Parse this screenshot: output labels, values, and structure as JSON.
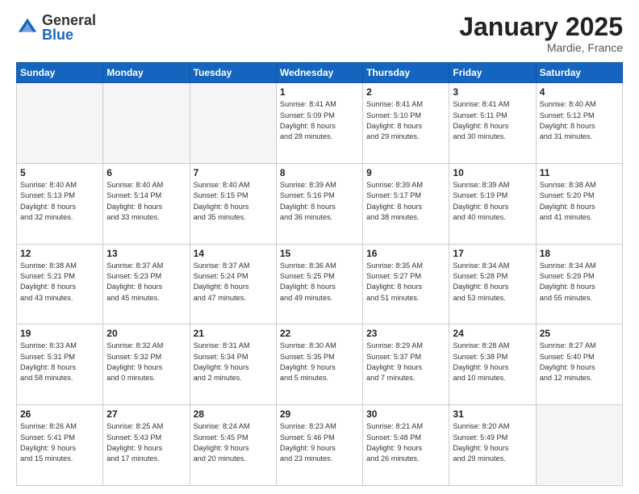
{
  "logo": {
    "general": "General",
    "blue": "Blue"
  },
  "header": {
    "month": "January 2025",
    "location": "Mardie, France"
  },
  "weekdays": [
    "Sunday",
    "Monday",
    "Tuesday",
    "Wednesday",
    "Thursday",
    "Friday",
    "Saturday"
  ],
  "weeks": [
    [
      {
        "day": "",
        "info": ""
      },
      {
        "day": "",
        "info": ""
      },
      {
        "day": "",
        "info": ""
      },
      {
        "day": "1",
        "info": "Sunrise: 8:41 AM\nSunset: 5:09 PM\nDaylight: 8 hours\nand 28 minutes."
      },
      {
        "day": "2",
        "info": "Sunrise: 8:41 AM\nSunset: 5:10 PM\nDaylight: 8 hours\nand 29 minutes."
      },
      {
        "day": "3",
        "info": "Sunrise: 8:41 AM\nSunset: 5:11 PM\nDaylight: 8 hours\nand 30 minutes."
      },
      {
        "day": "4",
        "info": "Sunrise: 8:40 AM\nSunset: 5:12 PM\nDaylight: 8 hours\nand 31 minutes."
      }
    ],
    [
      {
        "day": "5",
        "info": "Sunrise: 8:40 AM\nSunset: 5:13 PM\nDaylight: 8 hours\nand 32 minutes."
      },
      {
        "day": "6",
        "info": "Sunrise: 8:40 AM\nSunset: 5:14 PM\nDaylight: 8 hours\nand 33 minutes."
      },
      {
        "day": "7",
        "info": "Sunrise: 8:40 AM\nSunset: 5:15 PM\nDaylight: 8 hours\nand 35 minutes."
      },
      {
        "day": "8",
        "info": "Sunrise: 8:39 AM\nSunset: 5:16 PM\nDaylight: 8 hours\nand 36 minutes."
      },
      {
        "day": "9",
        "info": "Sunrise: 8:39 AM\nSunset: 5:17 PM\nDaylight: 8 hours\nand 38 minutes."
      },
      {
        "day": "10",
        "info": "Sunrise: 8:39 AM\nSunset: 5:19 PM\nDaylight: 8 hours\nand 40 minutes."
      },
      {
        "day": "11",
        "info": "Sunrise: 8:38 AM\nSunset: 5:20 PM\nDaylight: 8 hours\nand 41 minutes."
      }
    ],
    [
      {
        "day": "12",
        "info": "Sunrise: 8:38 AM\nSunset: 5:21 PM\nDaylight: 8 hours\nand 43 minutes."
      },
      {
        "day": "13",
        "info": "Sunrise: 8:37 AM\nSunset: 5:23 PM\nDaylight: 8 hours\nand 45 minutes."
      },
      {
        "day": "14",
        "info": "Sunrise: 8:37 AM\nSunset: 5:24 PM\nDaylight: 8 hours\nand 47 minutes."
      },
      {
        "day": "15",
        "info": "Sunrise: 8:36 AM\nSunset: 5:25 PM\nDaylight: 8 hours\nand 49 minutes."
      },
      {
        "day": "16",
        "info": "Sunrise: 8:35 AM\nSunset: 5:27 PM\nDaylight: 8 hours\nand 51 minutes."
      },
      {
        "day": "17",
        "info": "Sunrise: 8:34 AM\nSunset: 5:28 PM\nDaylight: 8 hours\nand 53 minutes."
      },
      {
        "day": "18",
        "info": "Sunrise: 8:34 AM\nSunset: 5:29 PM\nDaylight: 8 hours\nand 55 minutes."
      }
    ],
    [
      {
        "day": "19",
        "info": "Sunrise: 8:33 AM\nSunset: 5:31 PM\nDaylight: 8 hours\nand 58 minutes."
      },
      {
        "day": "20",
        "info": "Sunrise: 8:32 AM\nSunset: 5:32 PM\nDaylight: 9 hours\nand 0 minutes."
      },
      {
        "day": "21",
        "info": "Sunrise: 8:31 AM\nSunset: 5:34 PM\nDaylight: 9 hours\nand 2 minutes."
      },
      {
        "day": "22",
        "info": "Sunrise: 8:30 AM\nSunset: 5:35 PM\nDaylight: 9 hours\nand 5 minutes."
      },
      {
        "day": "23",
        "info": "Sunrise: 8:29 AM\nSunset: 5:37 PM\nDaylight: 9 hours\nand 7 minutes."
      },
      {
        "day": "24",
        "info": "Sunrise: 8:28 AM\nSunset: 5:38 PM\nDaylight: 9 hours\nand 10 minutes."
      },
      {
        "day": "25",
        "info": "Sunrise: 8:27 AM\nSunset: 5:40 PM\nDaylight: 9 hours\nand 12 minutes."
      }
    ],
    [
      {
        "day": "26",
        "info": "Sunrise: 8:26 AM\nSunset: 5:41 PM\nDaylight: 9 hours\nand 15 minutes."
      },
      {
        "day": "27",
        "info": "Sunrise: 8:25 AM\nSunset: 5:43 PM\nDaylight: 9 hours\nand 17 minutes."
      },
      {
        "day": "28",
        "info": "Sunrise: 8:24 AM\nSunset: 5:45 PM\nDaylight: 9 hours\nand 20 minutes."
      },
      {
        "day": "29",
        "info": "Sunrise: 8:23 AM\nSunset: 5:46 PM\nDaylight: 9 hours\nand 23 minutes."
      },
      {
        "day": "30",
        "info": "Sunrise: 8:21 AM\nSunset: 5:48 PM\nDaylight: 9 hours\nand 26 minutes."
      },
      {
        "day": "31",
        "info": "Sunrise: 8:20 AM\nSunset: 5:49 PM\nDaylight: 9 hours\nand 29 minutes."
      },
      {
        "day": "",
        "info": ""
      }
    ]
  ]
}
